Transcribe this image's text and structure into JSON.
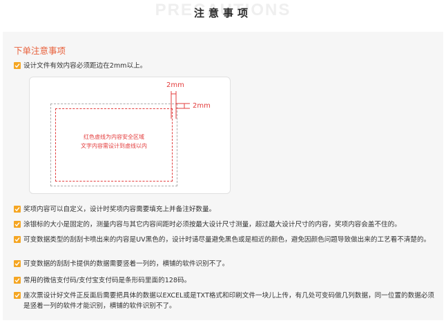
{
  "header": {
    "watermark": "PRECAUTIONS",
    "title": "注意事项"
  },
  "section": {
    "title": "下单注意事项"
  },
  "items": [
    "设计文件有效内容必须距边在2mm以上。",
    "奖项内容可以自定义，设计时奖项内容需要填充上并备注好数量。",
    "涂银标的大小是固定的，测量内容与其它内容间距时必须按最大设计尺寸测量，超过最大设计尺寸的内容，奖项内容会盖不住的。",
    "可变数据类型的刮刮卡喷出来的内容是UV黑色的，设计时请尽量避免黑色或是相近的颜色，避免因颜色问题导致做出来的工艺看不清楚的。",
    "可变数据的刮刮卡提供的数据需要竖着一列的，横铺的软件识别不了。",
    "常用的微信支付码/支付宝支付码是条形码里面的128码。",
    "座次票设计好文件正反面后需要把具体的数据以EXCEL或是TXT格式和印刷文件一块儿上传，有几处可变码做几列数据，同一位置的数据必须是竖着一列的软件才能识别，横铺的软件识别不了。"
  ],
  "diagram": {
    "dim_top": "2mm",
    "dim_right": "2mm",
    "safe_line1": "红色虚线为内容安全区域",
    "safe_line2": "文字内容需设计到虚线以内"
  },
  "colors": {
    "accent": "#e8613c",
    "check": "#f5a623",
    "safe_line": "#e33c3c"
  }
}
